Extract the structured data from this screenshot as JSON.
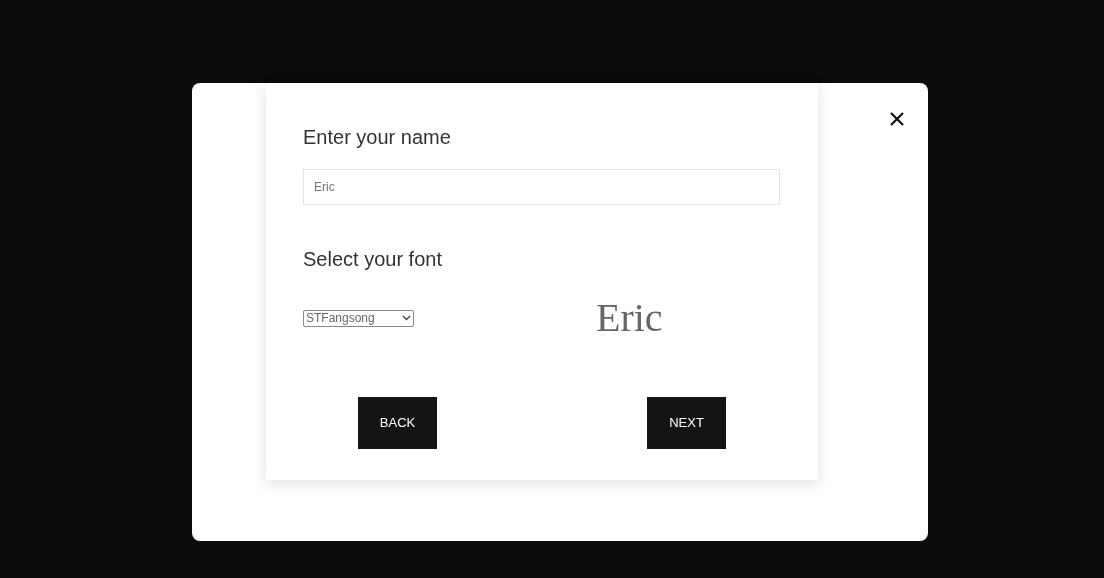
{
  "name_section": {
    "heading": "Enter your name",
    "value": "Eric"
  },
  "font_section": {
    "heading": "Select your font",
    "selected_font": "STFangsong",
    "preview": "Eric"
  },
  "buttons": [
    {
      "label": "BACK"
    },
    {
      "label": "NEXT"
    }
  ]
}
